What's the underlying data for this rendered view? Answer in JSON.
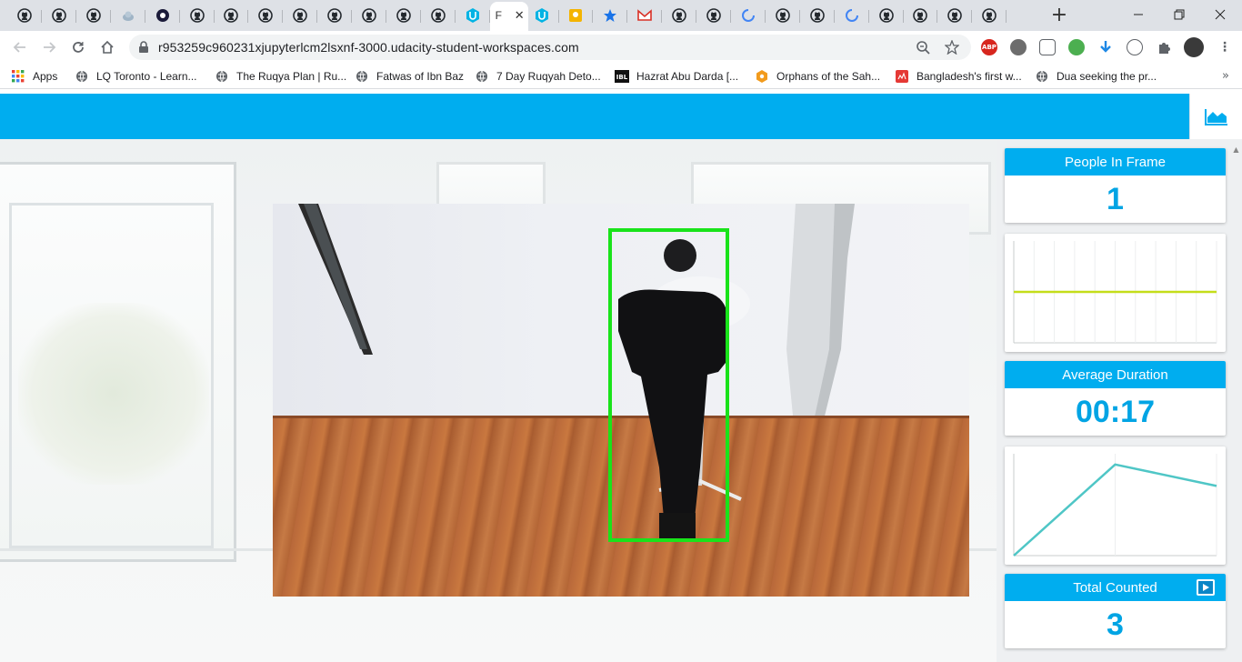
{
  "browser": {
    "tabs": [
      {
        "icon": "github-icon"
      },
      {
        "icon": "github-icon"
      },
      {
        "icon": "github-icon"
      },
      {
        "icon": "cloud-icon"
      },
      {
        "icon": "circle-logo-icon"
      },
      {
        "icon": "github-icon"
      },
      {
        "icon": "github-icon"
      },
      {
        "icon": "github-icon"
      },
      {
        "icon": "github-icon"
      },
      {
        "icon": "github-icon"
      },
      {
        "icon": "github-icon"
      },
      {
        "icon": "github-icon"
      },
      {
        "icon": "github-icon"
      },
      {
        "icon": "udacity-icon"
      },
      {
        "icon": "page-icon",
        "active": true,
        "label": "F"
      },
      {
        "icon": "udacity-icon"
      },
      {
        "icon": "bulb-icon"
      },
      {
        "icon": "star-icon"
      },
      {
        "icon": "gmail-icon"
      },
      {
        "icon": "github-icon"
      },
      {
        "icon": "github-icon"
      },
      {
        "icon": "loading-icon"
      },
      {
        "icon": "github-icon"
      },
      {
        "icon": "github-icon"
      },
      {
        "icon": "loading-icon"
      },
      {
        "icon": "github-icon"
      },
      {
        "icon": "github-icon"
      },
      {
        "icon": "github-icon"
      },
      {
        "icon": "github-icon"
      }
    ],
    "active_tab_label": "F",
    "url": "r953259c960231xjupyterlcm2lsxnf-3000.udacity-student-workspaces.com",
    "bookmarks": [
      {
        "icon": "apps-grid-icon",
        "label": "Apps"
      },
      {
        "icon": "globe-icon",
        "label": "LQ Toronto - Learn..."
      },
      {
        "icon": "globe-icon",
        "label": "The Ruqya Plan | Ru..."
      },
      {
        "icon": "globe-icon",
        "label": "Fatwas of Ibn Baz"
      },
      {
        "icon": "globe-icon",
        "label": "7 Day Ruqyah Deto..."
      },
      {
        "icon": "ibl-icon",
        "label": "Hazrat Abu Darda [..."
      },
      {
        "icon": "orange-hex-icon",
        "label": "Orphans of the Sah..."
      },
      {
        "icon": "red-flag-icon",
        "label": "Bangladesh's first w..."
      },
      {
        "icon": "globe-icon",
        "label": "Dua seeking the pr..."
      }
    ],
    "ibl_badge": "IBL",
    "abp_badge": "ABP"
  },
  "stats": {
    "people_in_frame": {
      "label": "People In Frame",
      "value": "1"
    },
    "average_duration": {
      "label": "Average Duration",
      "value": "00:17"
    },
    "total_counted": {
      "label": "Total Counted",
      "value": "3"
    }
  },
  "colors": {
    "brand": "#00adef",
    "bbox": "#19e31a",
    "people_chart_line": "#c4dd1a",
    "duration_chart_line": "#4fc6c6"
  },
  "chart_data": [
    {
      "type": "line",
      "series": [
        {
          "values": [
            1,
            1,
            1,
            1,
            1,
            1,
            1,
            1,
            1,
            1,
            1
          ]
        }
      ],
      "grid": true
    },
    {
      "type": "line",
      "series": [
        {
          "values": [
            0,
            17,
            13
          ]
        }
      ],
      "grid": true
    }
  ]
}
